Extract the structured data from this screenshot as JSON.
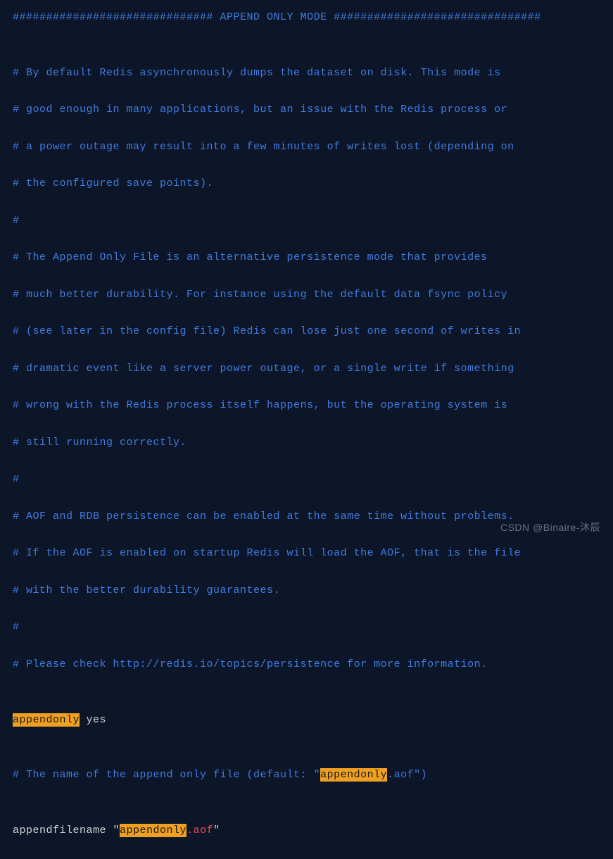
{
  "lines": {
    "l01": "############################## APPEND ONLY MODE ###############################",
    "l02": "",
    "l03": "# By default Redis asynchronously dumps the dataset on disk. This mode is",
    "l04": "# good enough in many applications, but an issue with the Redis process or",
    "l05": "# a power outage may result into a few minutes of writes lost (depending on",
    "l06": "# the configured save points).",
    "l07": "#",
    "l08": "# The Append Only File is an alternative persistence mode that provides",
    "l09": "# much better durability. For instance using the default data fsync policy",
    "l10": "# (see later in the config file) Redis can lose just one second of writes in",
    "l11": "# dramatic event like a server power outage, or a single write if something",
    "l12": "# wrong with the Redis process itself happens, but the operating system is",
    "l13": "# still running correctly.",
    "l14": "#",
    "l15": "# AOF and RDB persistence can be enabled at the same time without problems.",
    "l16": "# If the AOF is enabled on startup Redis will load the AOF, that is the file",
    "l17": "# with the better durability guarantees.",
    "l18": "#",
    "l19": "# Please check http://redis.io/topics/persistence for more information.",
    "l20": "",
    "l21_highlight": "appendonly",
    "l21_value": " yes",
    "l22": "",
    "l23_prefix": "# The name of the append only file (default: \"",
    "l23_highlight": "appendonly",
    "l23_suffix": ".aof\")",
    "l24": "",
    "l25_directive": "appendfilename ",
    "l25_quote1": "\"",
    "l25_highlight": "appendonly",
    "l25_ext": ".aof",
    "l25_quote2": "\""
  },
  "watermark": "CSDN @Binaire-沐辰"
}
